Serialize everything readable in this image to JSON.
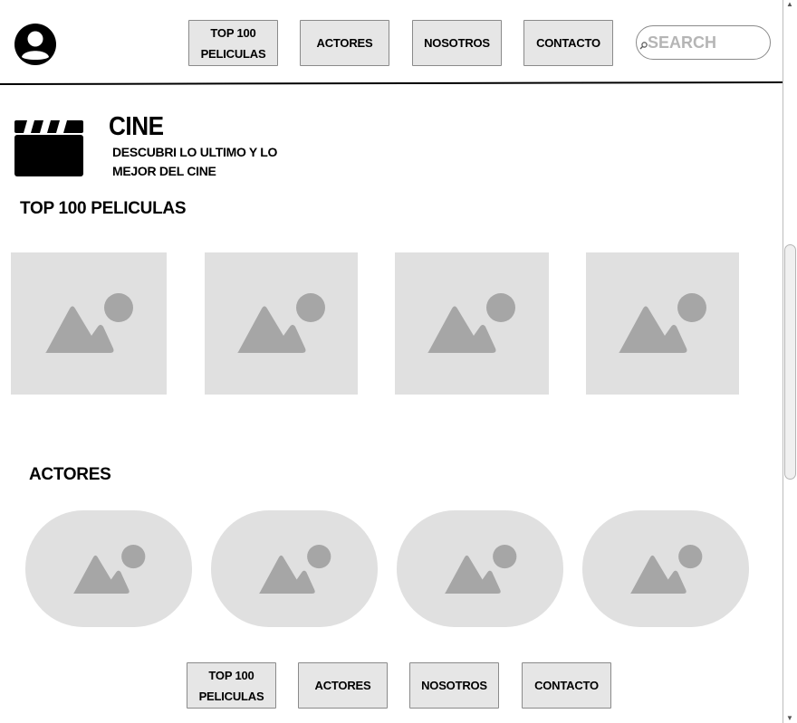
{
  "header": {
    "avatar_icon": "user-avatar-icon",
    "nav": [
      {
        "label": "TOP 100\nPELICULAS"
      },
      {
        "label": "ACTORES"
      },
      {
        "label": "NOSOTROS"
      },
      {
        "label": "CONTACTO"
      }
    ],
    "search": {
      "placeholder": "SEARCH",
      "value": "",
      "icon": "search-icon"
    }
  },
  "hero": {
    "icon": "clapperboard-icon",
    "title": "CINE",
    "subtitle": "DESCUBRI LO ULTIMO Y LO MEJOR DEL CINE"
  },
  "sections": {
    "movies": {
      "heading": "TOP 100 PELICULAS",
      "count": 4,
      "item_icon": "image-placeholder-icon"
    },
    "actors": {
      "heading": "ACTORES",
      "count": 4,
      "item_icon": "image-placeholder-icon"
    }
  },
  "footer": {
    "nav": [
      {
        "label": "TOP 100\nPELICULAS"
      },
      {
        "label": "ACTORES"
      },
      {
        "label": "NOSOTROS"
      },
      {
        "label": "CONTACTO"
      }
    ]
  },
  "colors": {
    "button_fill": "#e6e6e6",
    "placeholder_fill": "#e0e0e0",
    "placeholder_icon": "#a6a6a6",
    "search_placeholder": "#b5b5b5"
  }
}
